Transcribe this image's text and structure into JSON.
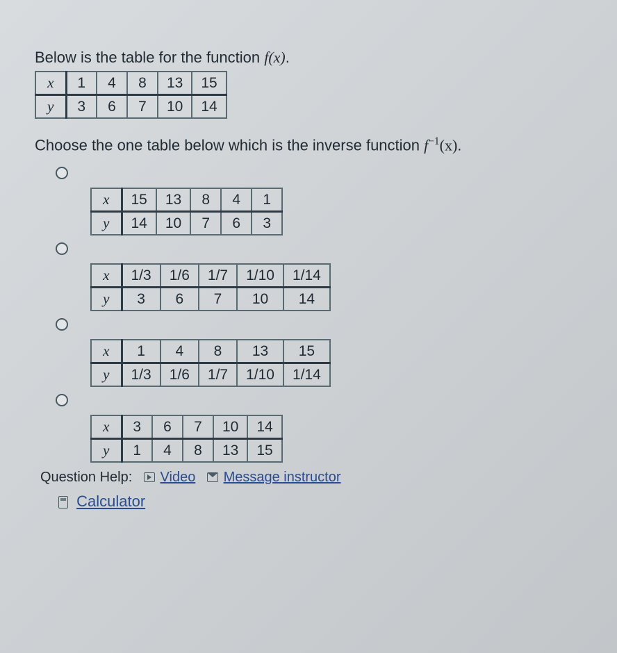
{
  "intro_prefix": "Below is the table for the function ",
  "intro_fn": "f(x)",
  "f_table": {
    "rowheads": [
      "x",
      "y"
    ],
    "rows": [
      [
        "1",
        "4",
        "8",
        "13",
        "15"
      ],
      [
        "3",
        "6",
        "7",
        "10",
        "14"
      ]
    ]
  },
  "prompt2_prefix": "Choose the one table below which is the inverse function ",
  "prompt2_fn": "f",
  "prompt2_exp": "−1",
  "prompt2_arg": "(x)",
  "punct": ".",
  "options": [
    {
      "rowheads": [
        "x",
        "y"
      ],
      "rows": [
        [
          "15",
          "13",
          "8",
          "4",
          "1"
        ],
        [
          "14",
          "10",
          "7",
          "6",
          "3"
        ]
      ]
    },
    {
      "rowheads": [
        "x",
        "y"
      ],
      "rows": [
        [
          "1/3",
          "1/6",
          "1/7",
          "1/10",
          "1/14"
        ],
        [
          "3",
          "6",
          "7",
          "10",
          "14"
        ]
      ]
    },
    {
      "rowheads": [
        "x",
        "y"
      ],
      "rows": [
        [
          "1",
          "4",
          "8",
          "13",
          "15"
        ],
        [
          "1/3",
          "1/6",
          "1/7",
          "1/10",
          "1/14"
        ]
      ]
    },
    {
      "rowheads": [
        "x",
        "y"
      ],
      "rows": [
        [
          "3",
          "6",
          "7",
          "10",
          "14"
        ],
        [
          "1",
          "4",
          "8",
          "13",
          "15"
        ]
      ]
    }
  ],
  "help_label": "Question Help:",
  "video_label": "Video",
  "message_label": "Message instructor",
  "calculator_label": "Calculator"
}
